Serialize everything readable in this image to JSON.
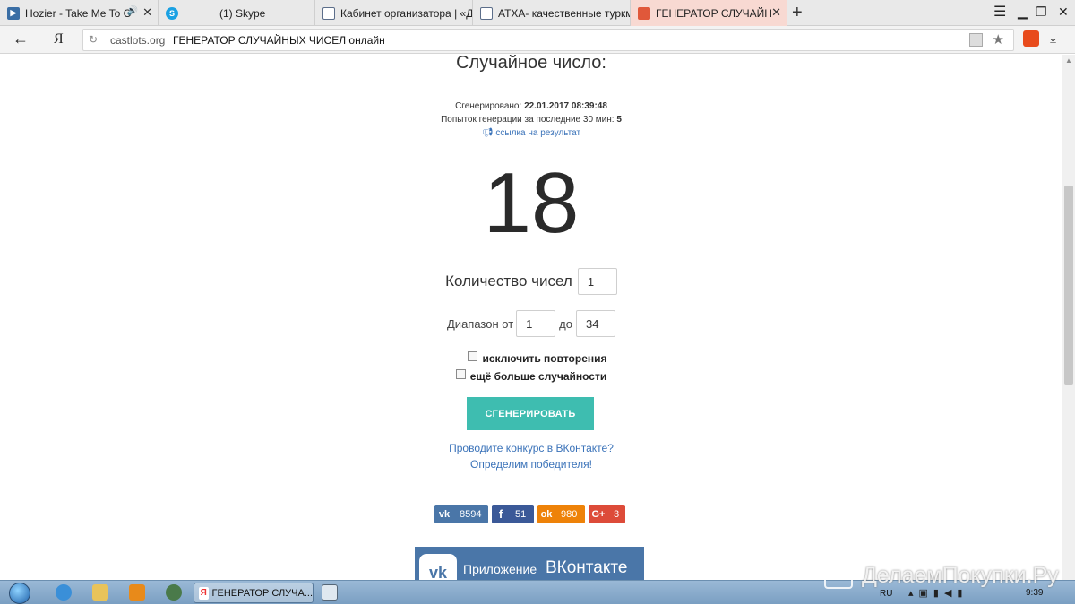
{
  "browser": {
    "tabs": [
      {
        "title": "Hozier - Take Me To C",
        "icon": "youtube-icon",
        "audio_icon": "🔊",
        "color": "#3a6ea5"
      },
      {
        "title": "(1) Skype",
        "icon": "skype-icon",
        "color": "#1aa1e3"
      },
      {
        "title": "Кабинет организатора | «Д",
        "icon": "page-icon",
        "color": "#5c6e8a"
      },
      {
        "title": "АТХА- качественные туркм",
        "icon": "page-icon",
        "color": "#5c6e8a"
      },
      {
        "title": "ГЕНЕРАТОР СЛУЧАЙНЫХ",
        "icon": "castlots-icon",
        "color": "#e0583a",
        "active": true
      }
    ],
    "new_tab_label": "+",
    "address": {
      "domain": "castlots.org",
      "page_title": "ГЕНЕРАТОР СЛУЧАЙНЫХ ЧИСЕЛ онлайн"
    },
    "yandex_logo": "Я"
  },
  "page": {
    "heading": "Случайное число:",
    "generated_label": "Сгенерировано:",
    "generated_value": "22.01.2017 08:39:48",
    "attempts_label": "Попыток генерации за последние 30 мин:",
    "attempts_value": "5",
    "result_link": "ссылка на результат",
    "result_number": "18",
    "count_label": "Количество чисел",
    "count_value": "1",
    "range_label": "Диапазон от",
    "range_from": "1",
    "range_to_label": "до",
    "range_to": "34",
    "checkbox_no_repeat": "исключить повторения",
    "checkbox_more_random": "ещё больше случайности",
    "generate_button": "СГЕНЕРИРОВАТЬ",
    "promo_line1": "Проводите конкурс в ВКонтакте?",
    "promo_line2": "Определим победителя!",
    "shares": [
      {
        "network": "vk",
        "icon_text": "vk",
        "count": "8594",
        "color": "#4a76a8"
      },
      {
        "network": "facebook",
        "icon_text": "f",
        "count": "51",
        "color": "#3b5998"
      },
      {
        "network": "odnoklassniki",
        "icon_text": "ok",
        "count": "980",
        "color": "#ee8208"
      },
      {
        "network": "google-plus",
        "icon_text": "G+",
        "count": "3",
        "color": "#dd4b39"
      }
    ],
    "vk_app_label": "Приложение",
    "vk_app_brand": "ВКонтакте",
    "vk_logo": "vk"
  },
  "taskbar": {
    "active_window": "ГЕНЕРАТОР СЛУЧА...",
    "language": "RU",
    "clock": "9:39"
  },
  "watermark": "ДелаемПокупки.Ру"
}
